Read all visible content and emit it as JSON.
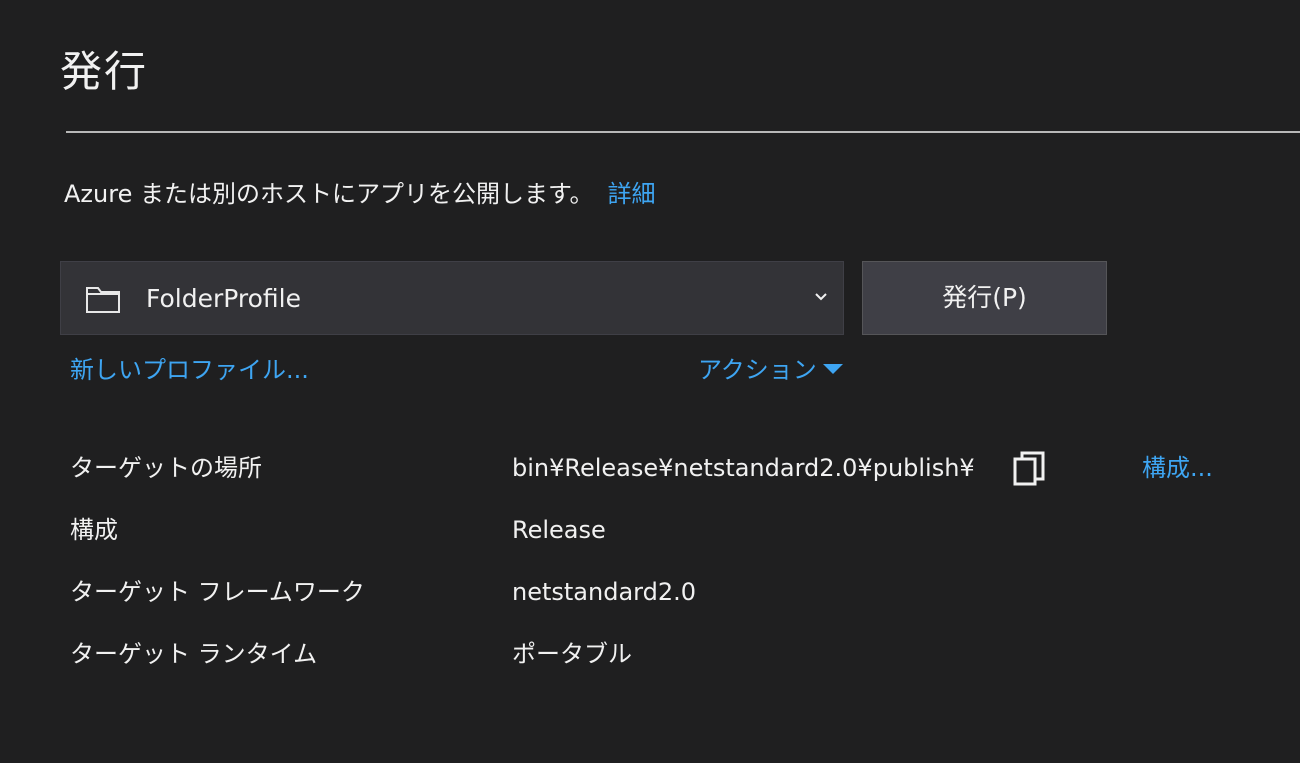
{
  "header": {
    "title": "発行"
  },
  "description": {
    "text": "Azure または別のホストにアプリを公開します。",
    "link": "詳細"
  },
  "profile": {
    "selected": "FolderProfile",
    "icon": "folder-icon"
  },
  "publish_button": {
    "label": "発行(P)"
  },
  "links": {
    "new_profile": "新しいプロファイル...",
    "actions": "アクション"
  },
  "properties": [
    {
      "label": "ターゲットの場所",
      "value": "bin¥Release¥netstandard2.0¥publish¥"
    },
    {
      "label": "構成",
      "value": "Release"
    },
    {
      "label": "ターゲット フレームワーク",
      "value": "netstandard2.0"
    },
    {
      "label": "ターゲット ランタイム",
      "value": "ポータブル"
    }
  ],
  "configure_link": "構成...",
  "colors": {
    "background": "#1f1f20",
    "link": "#3ea5f2",
    "input_background": "#333337",
    "button_background": "#3f3f46"
  }
}
